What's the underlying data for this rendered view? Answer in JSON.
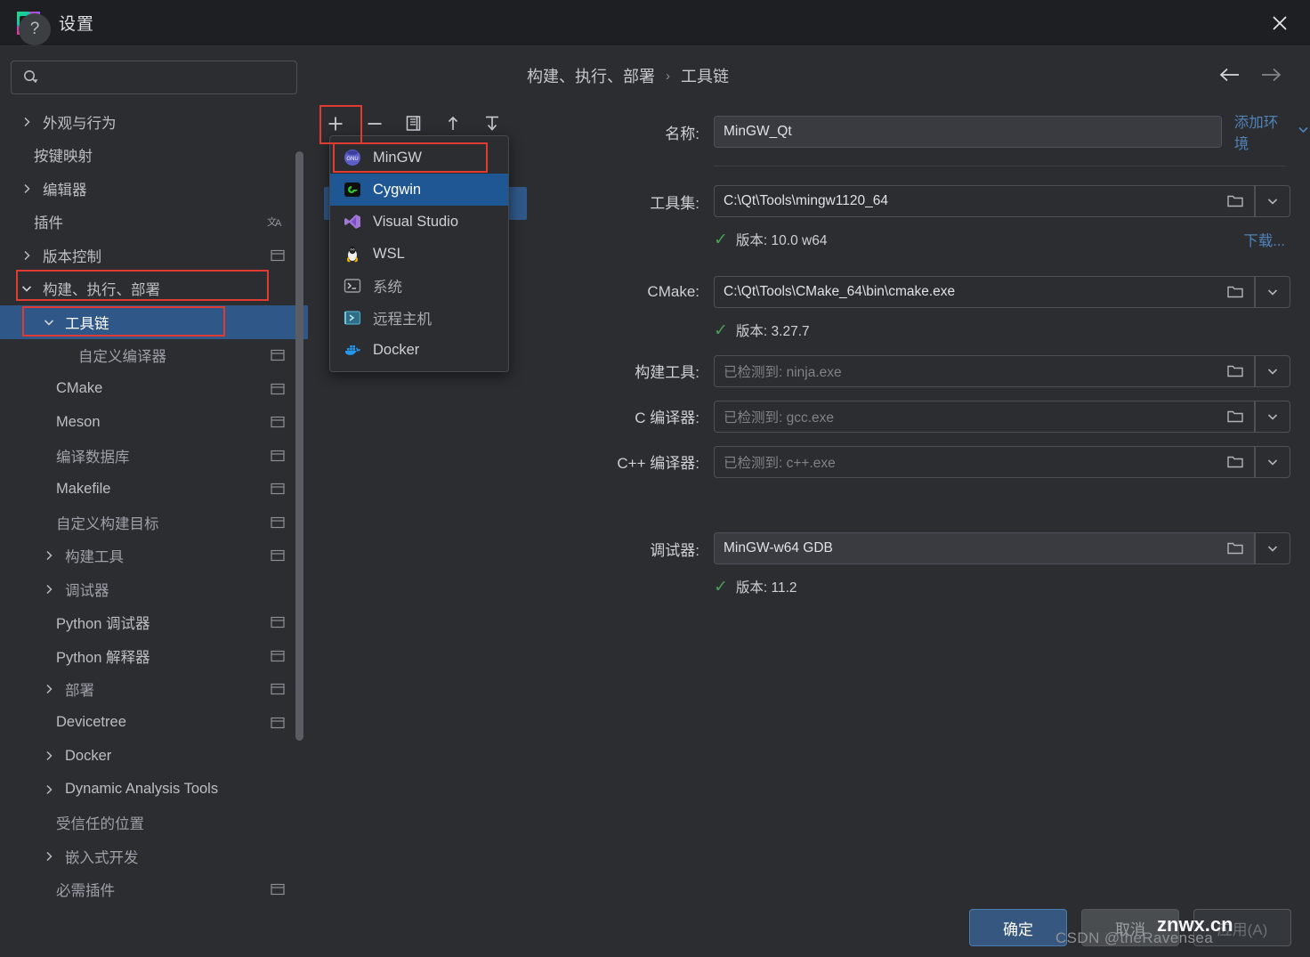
{
  "window": {
    "title": "设置",
    "logo_icon": "clion-logo-icon",
    "close_icon": "close-icon"
  },
  "sidebar": {
    "search": {
      "placeholder": "",
      "value": "",
      "icon": "search-icon"
    },
    "items": [
      {
        "label": "外观与行为",
        "indent": 0,
        "arrow": "right",
        "trail": "",
        "dim": false,
        "selected": false
      },
      {
        "label": "按键映射",
        "indent": 0,
        "arrow": "none",
        "trail": "",
        "dim": false,
        "selected": false
      },
      {
        "label": "编辑器",
        "indent": 0,
        "arrow": "right",
        "trail": "",
        "dim": false,
        "selected": false
      },
      {
        "label": "插件",
        "indent": 0,
        "arrow": "none",
        "trail": "translate",
        "dim": false,
        "selected": false
      },
      {
        "label": "版本控制",
        "indent": 0,
        "arrow": "right",
        "trail": "module",
        "dim": false,
        "selected": false
      },
      {
        "label": "构建、执行、部署",
        "indent": 0,
        "arrow": "down",
        "trail": "",
        "dim": false,
        "selected": false
      },
      {
        "label": "工具链",
        "indent": 1,
        "arrow": "down",
        "trail": "",
        "dim": false,
        "selected": true
      },
      {
        "label": "自定义编译器",
        "indent": 2,
        "arrow": "none",
        "trail": "module",
        "dim": true,
        "selected": false
      },
      {
        "label": "CMake",
        "indent": 1,
        "arrow": "none",
        "trail": "module",
        "dim": false,
        "selected": false
      },
      {
        "label": "Meson",
        "indent": 1,
        "arrow": "none",
        "trail": "module",
        "dim": false,
        "selected": false
      },
      {
        "label": "编译数据库",
        "indent": 1,
        "arrow": "none",
        "trail": "module",
        "dim": true,
        "selected": false
      },
      {
        "label": "Makefile",
        "indent": 1,
        "arrow": "none",
        "trail": "module",
        "dim": false,
        "selected": false
      },
      {
        "label": "自定义构建目标",
        "indent": 1,
        "arrow": "none",
        "trail": "module",
        "dim": true,
        "selected": false
      },
      {
        "label": "构建工具",
        "indent": 1,
        "arrow": "right",
        "trail": "module",
        "dim": true,
        "selected": false
      },
      {
        "label": "调试器",
        "indent": 1,
        "arrow": "right",
        "trail": "",
        "dim": true,
        "selected": false
      },
      {
        "label": "Python 调试器",
        "indent": 1,
        "arrow": "none",
        "trail": "module",
        "dim": false,
        "selected": false
      },
      {
        "label": "Python 解释器",
        "indent": 1,
        "arrow": "none",
        "trail": "module",
        "dim": false,
        "selected": false
      },
      {
        "label": "部署",
        "indent": 1,
        "arrow": "right",
        "trail": "module",
        "dim": true,
        "selected": false
      },
      {
        "label": "Devicetree",
        "indent": 1,
        "arrow": "none",
        "trail": "module",
        "dim": false,
        "selected": false
      },
      {
        "label": "Docker",
        "indent": 1,
        "arrow": "right",
        "trail": "",
        "dim": false,
        "selected": false
      },
      {
        "label": "Dynamic Analysis Tools",
        "indent": 1,
        "arrow": "right",
        "trail": "",
        "dim": false,
        "selected": false
      },
      {
        "label": "受信任的位置",
        "indent": 1,
        "arrow": "none",
        "trail": "",
        "dim": true,
        "selected": false
      },
      {
        "label": "嵌入式开发",
        "indent": 1,
        "arrow": "right",
        "trail": "",
        "dim": true,
        "selected": false
      },
      {
        "label": "必需插件",
        "indent": 1,
        "arrow": "none",
        "trail": "module",
        "dim": true,
        "selected": false
      }
    ]
  },
  "toolchain_list": {
    "toolbar": [
      {
        "name": "add-toolchain-button",
        "icon": "plus-icon"
      },
      {
        "name": "remove-toolchain-button",
        "icon": "minus-icon"
      },
      {
        "name": "copy-toolchain-button",
        "icon": "copy-icon"
      },
      {
        "name": "move-up-button",
        "icon": "arrow-up-icon"
      },
      {
        "name": "move-to-bottom-button",
        "icon": "arrow-to-bottom-icon"
      }
    ],
    "hidden_selected_item": ")"
  },
  "add_menu": {
    "items": [
      {
        "label": "MinGW",
        "icon": "gnu-icon",
        "highlighted": false,
        "dim": false
      },
      {
        "label": "Cygwin",
        "icon": "cygwin-icon",
        "highlighted": true,
        "dim": false
      },
      {
        "label": "Visual Studio",
        "icon": "visual-studio-icon",
        "highlighted": false,
        "dim": false
      },
      {
        "label": "WSL",
        "icon": "linux-penguin-icon",
        "highlighted": false,
        "dim": false
      },
      {
        "label": "系统",
        "icon": "terminal-icon",
        "highlighted": false,
        "dim": true
      },
      {
        "label": "远程主机",
        "icon": "remote-host-icon",
        "highlighted": false,
        "dim": true
      },
      {
        "label": "Docker",
        "icon": "docker-icon",
        "highlighted": false,
        "dim": false
      }
    ]
  },
  "content": {
    "breadcrumb": {
      "parent": "构建、执行、部署",
      "separator": "›",
      "current": "工具链"
    },
    "nav": {
      "back_icon": "arrow-left-icon",
      "forward_icon": "arrow-right-icon"
    },
    "name_row": {
      "label": "名称:",
      "value": "MinGW_Qt",
      "add_env_link": "添加环境",
      "add_env_caret": "chevron-down-icon"
    },
    "toolset_row": {
      "label": "工具集:",
      "value": "C:\\Qt\\Tools\\mingw1120_64",
      "status": "版本: 10.0 w64",
      "status_ok": true,
      "download_link": "下载..."
    },
    "cmake_row": {
      "label": "CMake:",
      "value": "C:\\Qt\\Tools\\CMake_64\\bin\\cmake.exe",
      "status": "版本: 3.27.7",
      "status_ok": true
    },
    "build_tool_row": {
      "label": "构建工具:",
      "placeholder": "已检测到: ninja.exe"
    },
    "c_compiler_row": {
      "label": "C 编译器:",
      "placeholder": "已检测到: gcc.exe"
    },
    "cpp_compiler_row": {
      "label": "C++ 编译器:",
      "placeholder": "已检测到: c++.exe"
    },
    "debugger_row": {
      "label": "调试器:",
      "value": "MinGW-w64 GDB",
      "status": "版本: 11.2",
      "status_ok": true
    },
    "icons": {
      "folder": "folder-icon",
      "dropdown": "chevron-down-icon",
      "check": "checkmark-icon"
    }
  },
  "footer": {
    "help_label": "?",
    "ok": "确定",
    "cancel": "取消",
    "apply": "应用(A)"
  },
  "watermark": {
    "csdn": "CSDN @theRavensea",
    "site": "znwx.cn"
  },
  "colors": {
    "accent_blue": "#2f5787",
    "menu_highlight": "#1f5694",
    "link": "#5182b8",
    "check_green": "#499c54",
    "annotation_red": "#e03b33",
    "panel_bg": "#2b2d30",
    "titlebar_bg": "#1e1f22"
  }
}
